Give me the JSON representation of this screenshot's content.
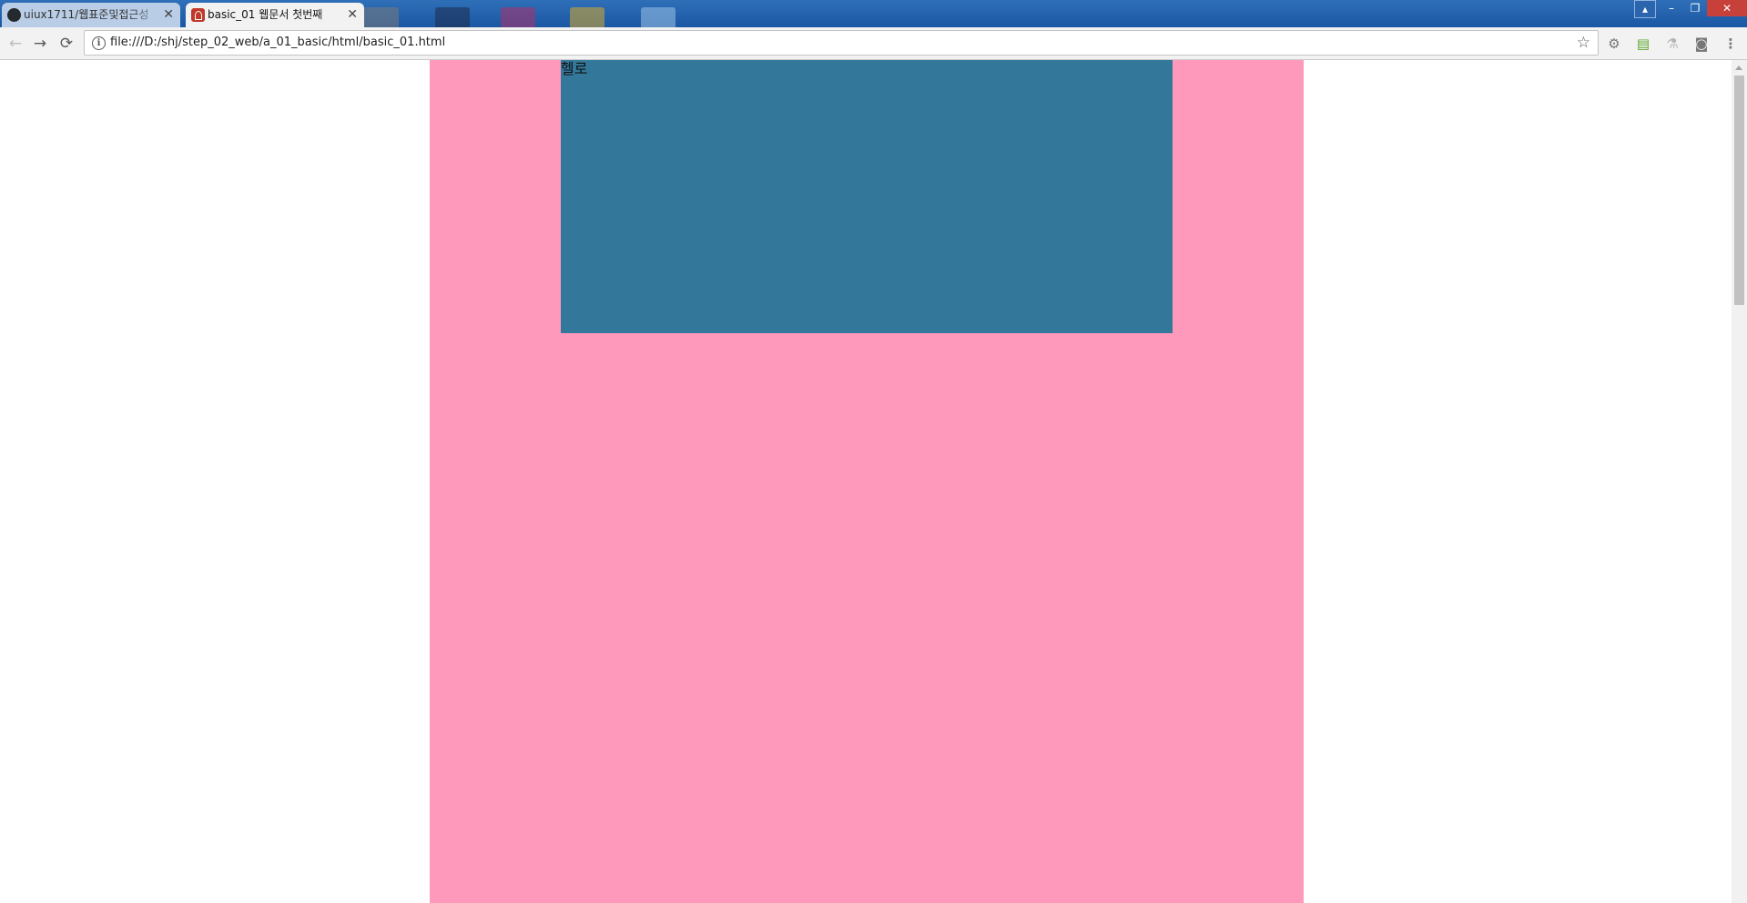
{
  "browser": {
    "tabs": [
      {
        "title": "uiux1711/웹표준및접근성",
        "favicon": "github-icon",
        "active": false
      },
      {
        "title": "basic_01 웹문서 첫번째",
        "favicon": "pdf-icon",
        "active": true
      }
    ],
    "close_glyph": "✕",
    "address": "file:///D:/shj/step_02_web/a_01_basic/html/basic_01.html",
    "info_glyph": "i",
    "nav": {
      "back": "←",
      "forward": "→",
      "reload": "⟳"
    },
    "star_glyph": "☆",
    "window_controls": {
      "minimize": "–",
      "restore": "❐",
      "close": "✕"
    },
    "extensions": [
      "⚙",
      "▤",
      "⚗",
      "◙",
      "⋮"
    ]
  },
  "page": {
    "text": "헬로",
    "colors": {
      "outer": "#ff99bb",
      "inner": "#33789a"
    }
  }
}
